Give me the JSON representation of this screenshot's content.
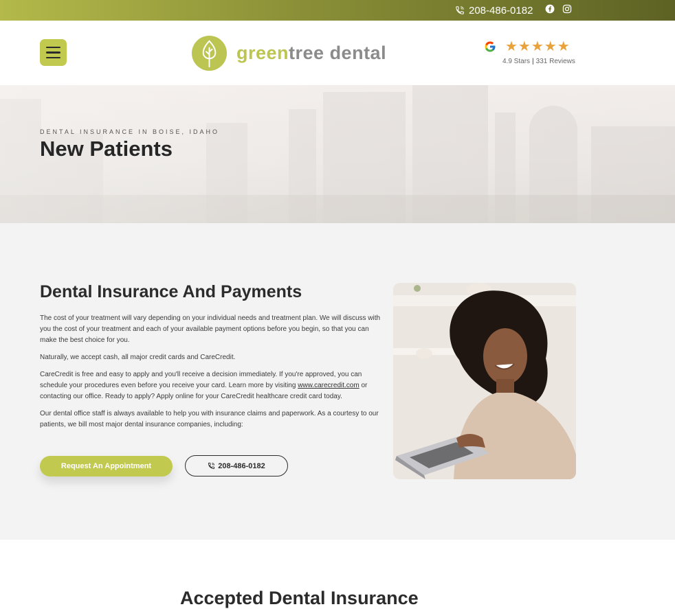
{
  "topbar": {
    "phone": "208-486-0182",
    "social": [
      "facebook-icon",
      "instagram-icon"
    ]
  },
  "header": {
    "logo_word1": "green",
    "logo_word2": "tree dental",
    "reviews": {
      "stars": "★★★★★",
      "rating_text": "4.9 Stars",
      "separator": "|",
      "count_text": "331 Reviews"
    }
  },
  "hero": {
    "kicker": "DENTAL INSURANCE IN BOISE, IDAHO",
    "title": "New Patients"
  },
  "main": {
    "heading": "Dental Insurance And Payments",
    "p1": "The cost of your treatment will vary depending on your individual needs and treatment plan. We will discuss with you the cost of your treatment and each of your available payment options before you begin, so that you can make the best choice for you.",
    "p2": "Naturally, we accept cash, all major credit cards and CareCredit.",
    "p3_before": "CareCredit is free and easy to apply and you'll receive a decision immediately. If you're approved, you can schedule your procedures even before you receive your card. Learn more by visiting ",
    "p3_link": "www.carecredit.com",
    "p3_after": " or contacting our office. Ready to apply? Apply online for your CareCredit healthcare credit card today.",
    "p4": "Our dental office staff is always available to help you with insurance claims and paperwork. As a courtesy to our patients, we bill most major dental insurance companies, including:",
    "cta_primary": "Request An Appointment",
    "cta_phone": "208-486-0182"
  },
  "next_section": {
    "heading": "Accepted Dental Insurance"
  },
  "colors": {
    "accent": "#c2c94f",
    "star": "#e9a23b",
    "topbar_dark": "#5d6224"
  }
}
